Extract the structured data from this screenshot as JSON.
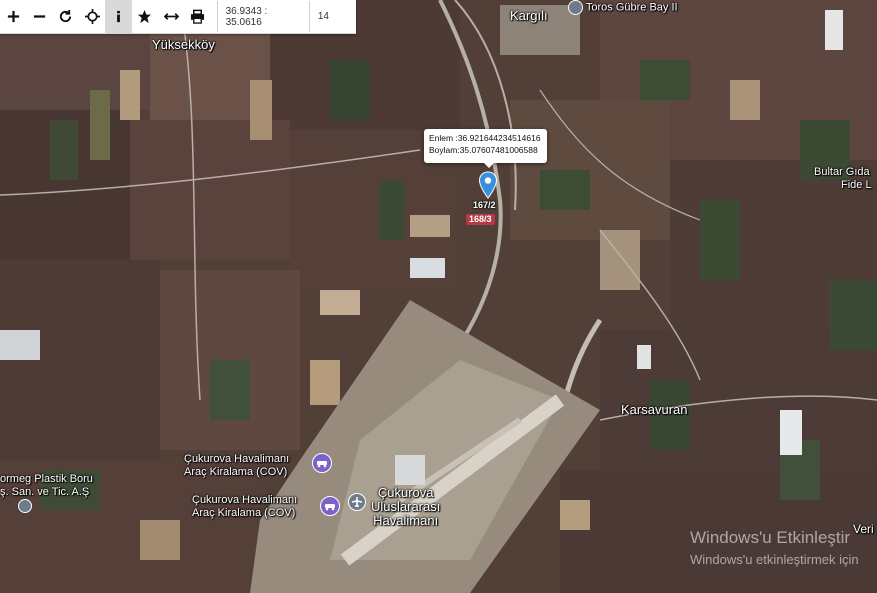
{
  "toolbar": {
    "buttons": [
      {
        "name": "zoom-in",
        "icon": "plus-icon"
      },
      {
        "name": "zoom-out",
        "icon": "minus-icon"
      },
      {
        "name": "refresh",
        "icon": "refresh-icon"
      },
      {
        "name": "locate",
        "icon": "crosshair-icon"
      },
      {
        "name": "info",
        "icon": "info-icon",
        "active": true
      },
      {
        "name": "favorites",
        "icon": "star-icon"
      },
      {
        "name": "measure",
        "icon": "arrows-horizontal-icon"
      },
      {
        "name": "print",
        "icon": "printer-icon"
      }
    ],
    "coordinates": "36.9343 : 35.0616",
    "zoom": "14"
  },
  "popup": {
    "latitude": "Enlem :36.921644234514616",
    "longitude": "Boylam:35.07607481006588"
  },
  "parcels": {
    "selected": "167/2",
    "adjacent": "168/3"
  },
  "places": {
    "kargili": "Kargılı",
    "toros": "Toros Gübre Bay II",
    "yuksekkoy": "Yüksekköy",
    "bultar": "Bultar Gıda",
    "fide": "Fide L",
    "karsavuran": "Karsavuran",
    "airport_rental_1_line1": "Çukurova Havalimanı",
    "airport_rental_1_line2": "Araç Kiralama (COV)",
    "airport_rental_2_line1": "Çukurova Havalimanı",
    "airport_rental_2_line2": "Araç Kiralama (COV)",
    "plastic_line1": "ormeg Plastik Boru",
    "plastic_line2": "ş. San. ve Tic. A.Ş",
    "airport_line1": "Çukurova",
    "airport_line2": "Uluslararası",
    "airport_line3": "Havalimanı",
    "veri": "Veri"
  },
  "watermark": {
    "line1": "Windows'u Etkinleştir",
    "line2": "Windows'u etkinleştirmek için"
  },
  "colors": {
    "marker": "#3a8fd9",
    "parcel_badge": "#b33a46",
    "poi_icon": "#7b63c9"
  }
}
